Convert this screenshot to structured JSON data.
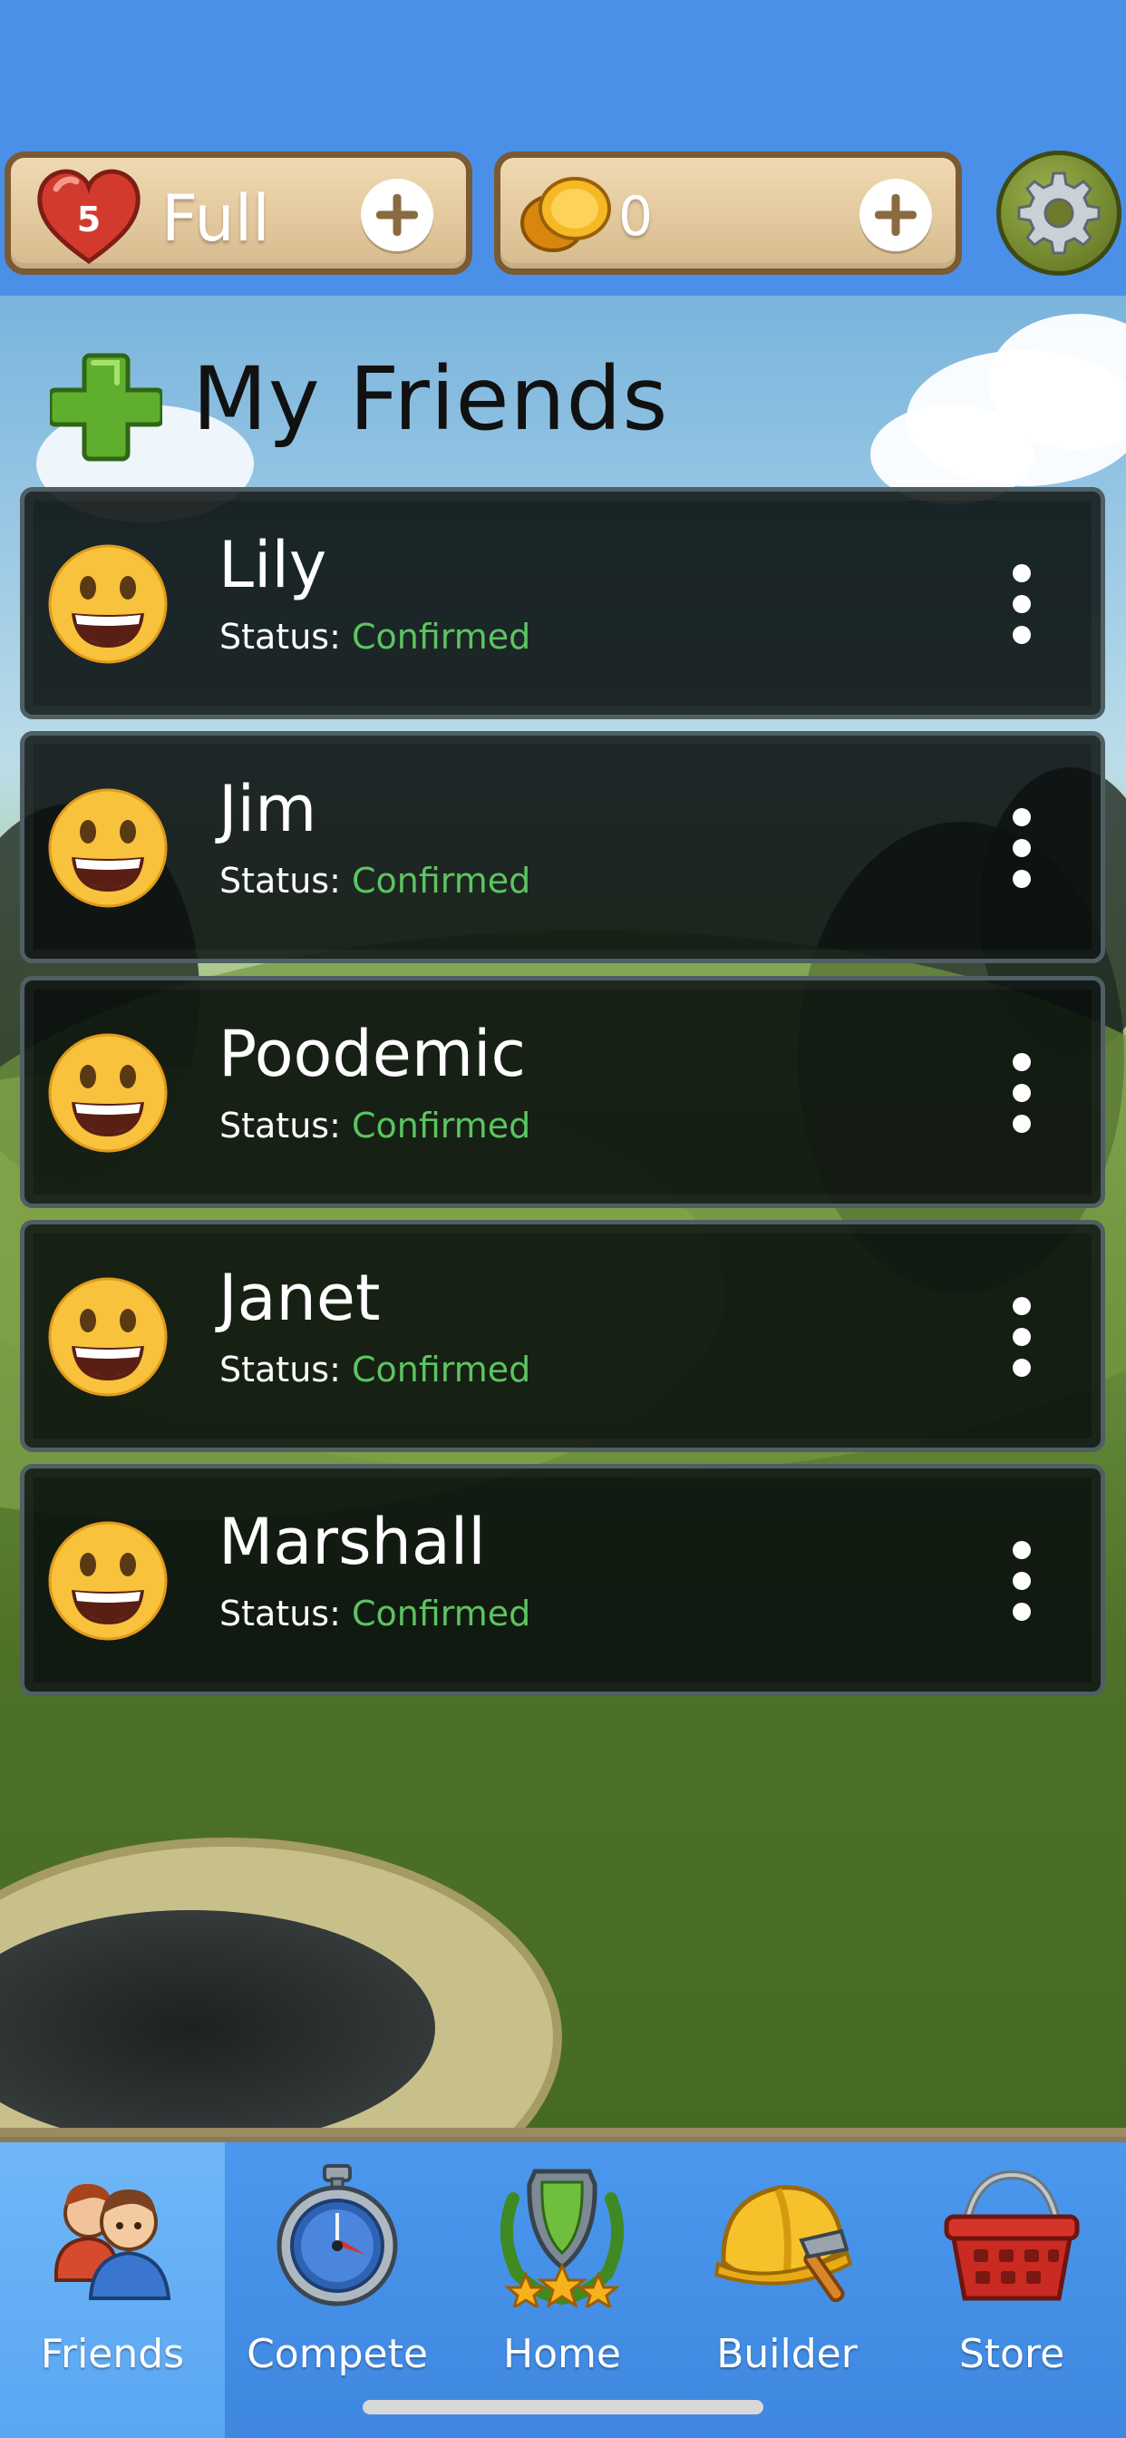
{
  "top_bar": {
    "lives": {
      "count": "5",
      "status": "Full",
      "icon": "heart-icon",
      "add_icon": "plus-icon"
    },
    "coins": {
      "count": "0",
      "icon": "coin-icon",
      "add_icon": "plus-icon"
    },
    "settings_icon": "gear-icon"
  },
  "header": {
    "title": "My Friends",
    "add_icon": "green-plus-icon"
  },
  "friends": [
    {
      "name": "Lily",
      "status_label": "Status:",
      "status": "Confirmed"
    },
    {
      "name": "Jim",
      "status_label": "Status:",
      "status": "Confirmed"
    },
    {
      "name": "Poodemic",
      "status_label": "Status:",
      "status": "Confirmed"
    },
    {
      "name": "Janet",
      "status_label": "Status:",
      "status": "Confirmed"
    },
    {
      "name": "Marshall",
      "status_label": "Status:",
      "status": "Confirmed"
    }
  ],
  "bottom_nav": {
    "items": [
      {
        "label": "Friends",
        "icon": "friends-icon",
        "active": true
      },
      {
        "label": "Compete",
        "icon": "stopwatch-icon",
        "active": false
      },
      {
        "label": "Home",
        "icon": "shield-laurel-icon",
        "active": false
      },
      {
        "label": "Builder",
        "icon": "hardhat-hammer-icon",
        "active": false
      },
      {
        "label": "Store",
        "icon": "basket-icon",
        "active": false
      }
    ]
  },
  "colors": {
    "sky_blue": "#4a90e8",
    "status_confirmed": "#5cc461",
    "card_bg": "#0b1210"
  }
}
